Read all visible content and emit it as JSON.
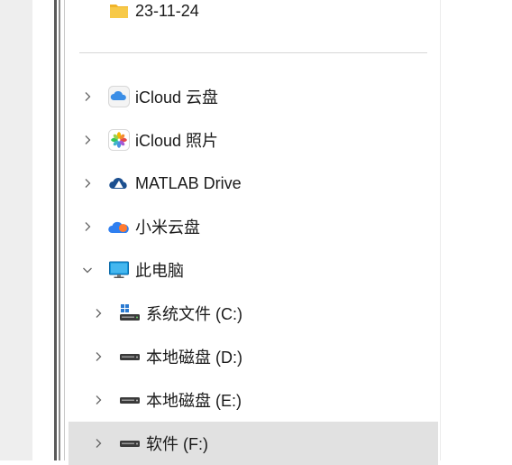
{
  "nav_tree": {
    "folder": {
      "label": "23-11-24",
      "icon": "folder-icon"
    },
    "items": [
      {
        "label": "iCloud 云盘",
        "icon": "icloud-drive-icon",
        "expanded": false
      },
      {
        "label": "iCloud 照片",
        "icon": "icloud-photos-icon",
        "expanded": false
      },
      {
        "label": "MATLAB Drive",
        "icon": "matlab-drive-icon",
        "expanded": false
      },
      {
        "label": "小米云盘",
        "icon": "xiaomi-cloud-icon",
        "expanded": false
      },
      {
        "label": "此电脑",
        "icon": "this-pc-icon",
        "expanded": true
      }
    ],
    "drives": [
      {
        "label": "系统文件 (C:)",
        "icon": "system-drive-icon",
        "selected": false
      },
      {
        "label": "本地磁盘 (D:)",
        "icon": "drive-icon",
        "selected": false
      },
      {
        "label": "本地磁盘 (E:)",
        "icon": "drive-icon",
        "selected": false
      },
      {
        "label": "软件 (F:)",
        "icon": "drive-icon",
        "selected": true
      }
    ]
  },
  "colors": {
    "folder": "#f7c948",
    "selection": "#e1e1e1",
    "icloud_blue": "#3b8ee6",
    "matlab_navy": "#1b4f8f",
    "monitor_blue": "#1296db"
  }
}
